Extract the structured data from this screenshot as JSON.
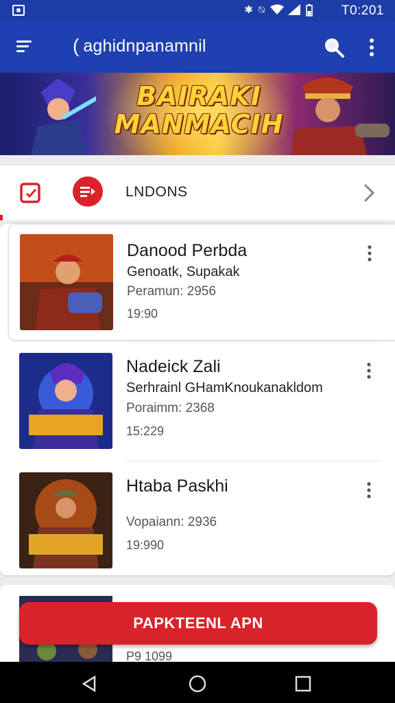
{
  "status_bar": {
    "time": "T0:201",
    "left_icon": "notification-icon"
  },
  "app_bar": {
    "title": "aghidnpanamnil",
    "back_glyph": "(",
    "icons": [
      "menu-icon",
      "search-icon",
      "more-vert-icon"
    ]
  },
  "banner": {
    "line1": "BAIRAKI",
    "line2": "MANMACIH"
  },
  "section": {
    "label": "LNDONS",
    "icons": [
      "checkbox-icon",
      "queue-icon",
      "chevron-right-icon"
    ]
  },
  "items": [
    {
      "title": "Danood Perbda",
      "subtitle": "Genoatk, Supakak",
      "meta": "Peramun: 2956",
      "time": "19:90"
    },
    {
      "title": "Nadeick Zali",
      "subtitle": "Serhrainl GHamKnoukanakldom",
      "meta": "Poraimm: 2368",
      "time": "15:229"
    },
    {
      "title": "Htaba Paskhi",
      "subtitle": "",
      "meta": "Vopaiann: 2936",
      "time": "19:990"
    }
  ],
  "partial_item": {
    "time": "P9 1099"
  },
  "cta": {
    "label": "PAPKTEENL APN"
  },
  "colors": {
    "app_bar": "#1f40b0",
    "accent_red": "#d8232a"
  }
}
